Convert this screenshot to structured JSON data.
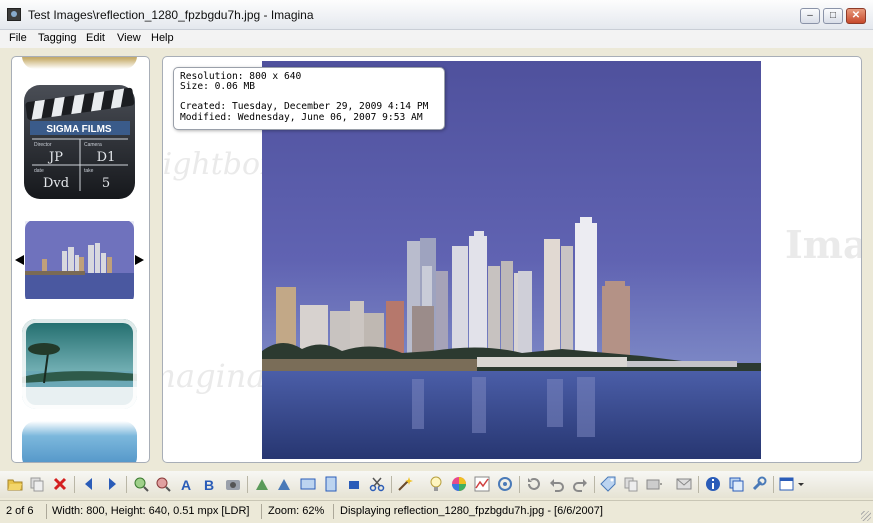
{
  "window": {
    "title": "Test Images\\reflection_1280_fpzbgdu7h.jpg - Imagina"
  },
  "menu": [
    "File",
    "Tagging",
    "Edit",
    "View",
    "Help"
  ],
  "thumbnails": {
    "clapperboard": {
      "brand": "SIGMA FILMS",
      "fields": [
        "Director",
        "Camera",
        "date",
        "take"
      ],
      "values": [
        "JP",
        "D1",
        "Dvd",
        "5"
      ]
    }
  },
  "watermark": {
    "brand": "Imagina",
    "sub": "lightbox"
  },
  "info": {
    "resolution": "Resolution: 800 x 640",
    "size": "Size: 0.06 MB",
    "created": "Created: Tuesday, December 29, 2009 4:14 PM",
    "modified": "Modified: Wednesday, June 06, 2007 9:53 AM"
  },
  "toolbar": {
    "icons": [
      "open-folder-icon",
      "copy-icon",
      "delete-icon",
      "previous-icon",
      "next-icon",
      "zoom-in-icon",
      "zoom-out-icon",
      "text-a-icon",
      "text-b-icon",
      "camera-icon",
      "flip-horizontal-icon",
      "flip-vertical-icon",
      "fit-width-icon",
      "fit-height-icon",
      "actual-size-icon",
      "crop-icon",
      "magic-wand-icon",
      "lightbulb-icon",
      "color-wheel-icon",
      "histogram-icon",
      "effects-icon",
      "rotate-icon",
      "undo-icon",
      "redo-icon",
      "tag-icon",
      "copy-page-icon",
      "slideshow-icon",
      "mail-icon",
      "info-icon",
      "properties-icon",
      "settings-wrench-icon",
      "window-layout-icon"
    ]
  },
  "status": {
    "position": "2 of 6",
    "dimensions": "Width: 800, Height: 640, 0.51 mpx [LDR]",
    "zoom": "Zoom: 62%",
    "message": "Displaying reflection_1280_fpzbgdu7h.jpg - [6/6/2007]"
  },
  "colors": {
    "accent": "#2a5cb8",
    "sky": "#5a5fae",
    "water": "#2d3f7e",
    "delete": "#d42020"
  }
}
